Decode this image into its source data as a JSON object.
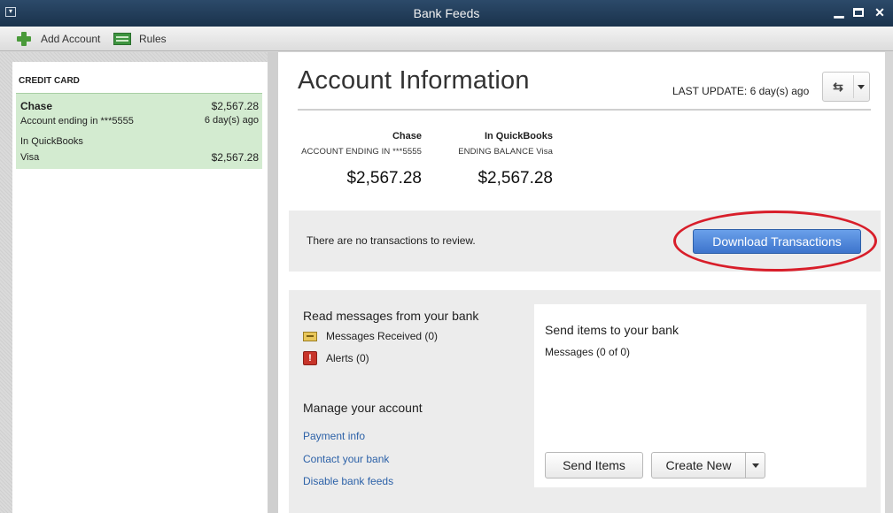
{
  "window": {
    "title": "Bank Feeds",
    "sysmenu_icon": "window-menu-icon",
    "controls": {
      "minimize": "▁",
      "close": "✕"
    }
  },
  "toolbar": {
    "add_account": "Add Account",
    "rules": "Rules",
    "icons": {
      "add_account": "plus-icon",
      "rules": "rules-icon"
    }
  },
  "sidebar": {
    "section_label": "CREDIT CARD",
    "selected_account": {
      "name": "Chase",
      "balance": "$2,567.28",
      "ending": "Account ending in ***5555",
      "updated": "6 day(s) ago",
      "in_qb_label": "In QuickBooks",
      "qb_account": "Visa",
      "qb_balance": "$2,567.28"
    },
    "selected_color": "#d3ebd0"
  },
  "main": {
    "title": "Account Information",
    "last_update": "LAST UPDATE: 6 day(s) ago",
    "refresh_icon": "⇆",
    "summary": {
      "bank": {
        "heading": "Chase",
        "sub": "ACCOUNT ENDING IN ***5555",
        "amount": "$2,567.28"
      },
      "qb": {
        "heading": "In QuickBooks",
        "sub": "ENDING BALANCE Visa",
        "amount": "$2,567.28"
      }
    },
    "review": {
      "message": "There are no transactions to review.",
      "download_button": "Download Transactions",
      "highlight_color": "#d81e2a"
    },
    "messages": {
      "heading": "Read messages from your bank",
      "received": "Messages Received (0)",
      "alerts": "Alerts (0)",
      "alert_glyph": "!"
    },
    "manage": {
      "heading": "Manage your account",
      "links": [
        "Payment info",
        "Contact your bank",
        "Disable bank feeds"
      ]
    },
    "send": {
      "heading": "Send items to your bank",
      "messages": "Messages (0 of 0)",
      "send_button": "Send Items",
      "create_button": "Create New"
    }
  }
}
